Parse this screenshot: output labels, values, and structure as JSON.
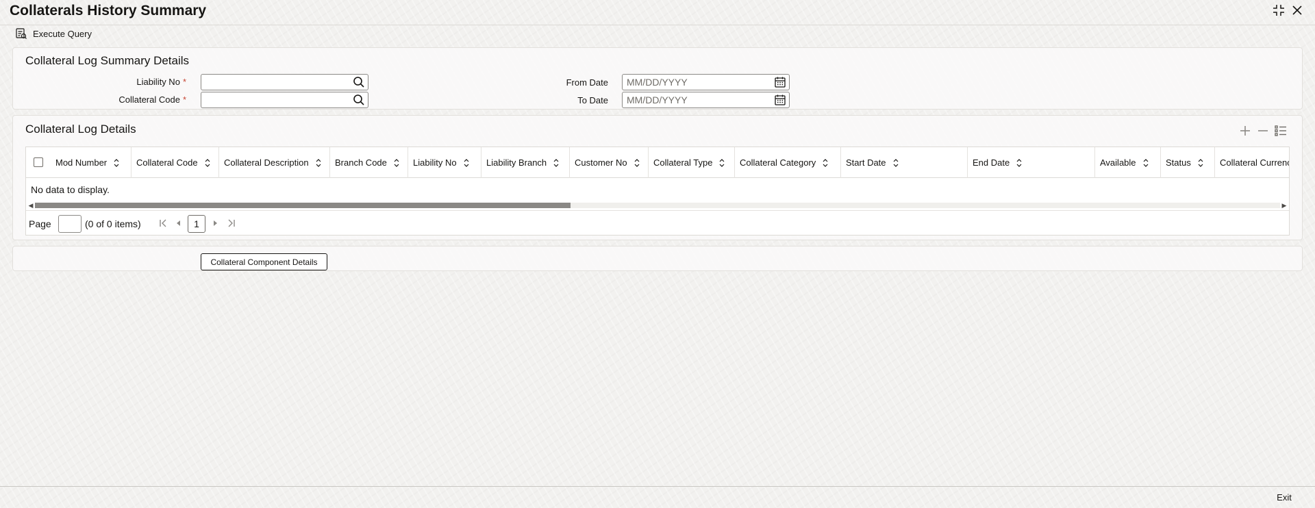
{
  "page": {
    "title": "Collaterals History Summary"
  },
  "toolbar": {
    "execute_query_label": "Execute Query"
  },
  "summary": {
    "title": "Collateral Log Summary Details",
    "liability_no": {
      "label": "Liability No",
      "value": "",
      "required_mark": "*"
    },
    "collateral_code": {
      "label": "Collateral Code",
      "value": "",
      "required_mark": "*"
    },
    "from_date": {
      "label": "From Date",
      "placeholder": "MM/DD/YYYY",
      "value": ""
    },
    "to_date": {
      "label": "To Date",
      "placeholder": "MM/DD/YYYY",
      "value": ""
    }
  },
  "log_details": {
    "title": "Collateral Log Details",
    "columns": [
      "Mod Number",
      "Collateral Code",
      "Collateral Description",
      "Branch Code",
      "Liability No",
      "Liability Branch",
      "Customer No",
      "Collateral Type",
      "Collateral Category",
      "Start Date",
      "End Date",
      "Available",
      "Status",
      "Collateral Currency"
    ],
    "rows": [],
    "empty_message": "No data to display.",
    "scroll_fraction": 0.43
  },
  "pagination": {
    "page_label": "Page",
    "page_value": "",
    "items_text": "(0 of 0 items)",
    "current_page": "1"
  },
  "component": {
    "button_label": "Collateral Component Details"
  },
  "footer": {
    "exit_label": "Exit"
  },
  "icons": {
    "execute_query": "execute-query-icon",
    "search": "search-icon",
    "calendar": "calendar-icon",
    "add": "plus-icon",
    "remove": "minus-icon",
    "columns": "list-icon",
    "sort": "sort-icon",
    "restore": "restore-window-icon",
    "close": "close-icon"
  },
  "colors": {
    "accent": "#c74634",
    "text": "#161513",
    "border": "#8b8985"
  }
}
